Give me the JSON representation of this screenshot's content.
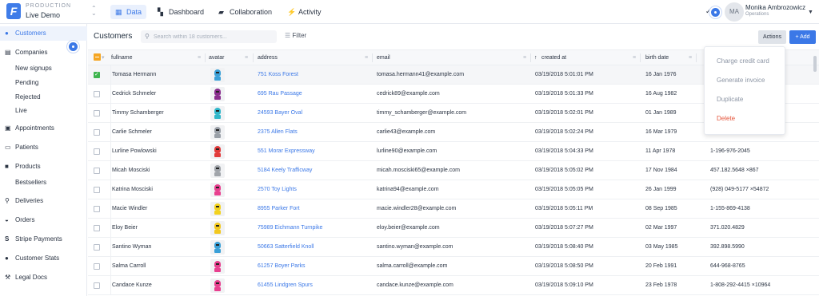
{
  "env": {
    "label": "PRODUCTION",
    "name": "Live Demo"
  },
  "nav": {
    "tabs": [
      {
        "label": "Data",
        "icon": "grid-icon"
      },
      {
        "label": "Dashboard",
        "icon": "dashboard-icon"
      },
      {
        "label": "Collaboration",
        "icon": "chat-icon"
      },
      {
        "label": "Activity",
        "icon": "bolt-icon"
      }
    ]
  },
  "user": {
    "initials": "MA",
    "name": "Monika Ambrozowicz",
    "role": "Operations"
  },
  "sidebar": {
    "items": [
      {
        "label": "Customers",
        "icon": "person-icon"
      },
      {
        "label": "Companies",
        "icon": "building-icon"
      },
      {
        "label": "New signups"
      },
      {
        "label": "Pending"
      },
      {
        "label": "Rejected"
      },
      {
        "label": "Live"
      },
      {
        "label": "Appointments",
        "icon": "calendar-icon"
      },
      {
        "label": "Patients",
        "icon": "id-card-icon"
      },
      {
        "label": "Products",
        "icon": "box-icon"
      },
      {
        "label": "Bestsellers"
      },
      {
        "label": "Deliveries",
        "icon": "pin-icon"
      },
      {
        "label": "Orders",
        "icon": "cart-icon"
      },
      {
        "label": "Stripe Payments",
        "icon": "stripe-icon"
      },
      {
        "label": "Customer Stats",
        "icon": "users-icon"
      },
      {
        "label": "Legal Docs",
        "icon": "gavel-icon"
      }
    ]
  },
  "main": {
    "title": "Customers",
    "search_placeholder": "Search within 18 customers...",
    "filter_label": "Filter",
    "actions_label": "Actions",
    "add_label": "+ Add"
  },
  "table": {
    "columns": [
      "fullname",
      "avatar",
      "address",
      "email",
      "created at",
      "birth date"
    ],
    "rows": [
      {
        "fullname": "Tomasa Hermann",
        "address": "751 Koss Forest",
        "email": "tomasa.hermann41@example.com",
        "created": "03/19/2018 5:01:01 PM",
        "birth": "16 Jan 1976",
        "phone": "",
        "color": "#3aa0d8",
        "checked": true
      },
      {
        "fullname": "Cedrick Schmeler",
        "address": "695 Rau Passage",
        "email": "cedrick89@example.com",
        "created": "03/19/2018 5:01:33 PM",
        "birth": "16 Aug 1982",
        "phone": "",
        "color": "#8a2d8e",
        "checked": false
      },
      {
        "fullname": "Timmy Schamberger",
        "address": "24593 Bayer Oval",
        "email": "timmy_schamberger@example.com",
        "created": "03/19/2018 5:02:01 PM",
        "birth": "01 Jan 1989",
        "phone": "",
        "color": "#2fb6c9",
        "checked": false
      },
      {
        "fullname": "Carlie Schmeler",
        "address": "2375 Allen Flats",
        "email": "carlie43@example.com",
        "created": "03/19/2018 5:02:24 PM",
        "birth": "16 Mar 1979",
        "phone": "",
        "color": "#9aa0a8",
        "checked": false
      },
      {
        "fullname": "Lurline Powlowski",
        "address": "551 Morar Expressway",
        "email": "lurline90@example.com",
        "created": "03/19/2018 5:04:33 PM",
        "birth": "11 Apr 1978",
        "phone": "1-196-976-2045",
        "color": "#e23b3b",
        "checked": false
      },
      {
        "fullname": "Micah Mosciski",
        "address": "5184 Keely Trafficway",
        "email": "micah.mosciski65@example.com",
        "created": "03/19/2018 5:05:02 PM",
        "birth": "17 Nov 1984",
        "phone": "457.182.5648 ×867",
        "color": "#a0a4aa",
        "checked": false
      },
      {
        "fullname": "Katrina Mosciski",
        "address": "2570 Toy Lights",
        "email": "katrina94@example.com",
        "created": "03/19/2018 5:05:05 PM",
        "birth": "26 Jan 1999",
        "phone": "(928) 049-5177 ×54872",
        "color": "#e8408f",
        "checked": false
      },
      {
        "fullname": "Macie Windler",
        "address": "8955 Parker Fort",
        "email": "macie.windler28@example.com",
        "created": "03/19/2018 5:05:11 PM",
        "birth": "08 Sep 1985",
        "phone": "1-155-869-4138",
        "color": "#f2d21f",
        "checked": false
      },
      {
        "fullname": "Eloy Beier",
        "address": "75989 Eichmann Turnpike",
        "email": "eloy.beier@example.com",
        "created": "03/19/2018 5:07:27 PM",
        "birth": "02 Mar 1997",
        "phone": "371.020.4829",
        "color": "#f2c81f",
        "checked": false
      },
      {
        "fullname": "Santino Wyman",
        "address": "50663 Satterfield Knoll",
        "email": "santino.wyman@example.com",
        "created": "03/19/2018 5:08:40 PM",
        "birth": "03 May 1985",
        "phone": "392.898.5990",
        "color": "#3aa0d8",
        "checked": false
      },
      {
        "fullname": "Salma Carroll",
        "address": "61257 Boyer Parks",
        "email": "salma.carroll@example.com",
        "created": "03/19/2018 5:08:50 PM",
        "birth": "20 Feb 1991",
        "phone": "644-968-8765",
        "color": "#e8408f",
        "checked": false
      },
      {
        "fullname": "Candace Kunze",
        "address": "61455 Lindgren Spurs",
        "email": "candace.kunze@example.com",
        "created": "03/19/2018 5:09:10 PM",
        "birth": "23 Feb 1978",
        "phone": "1-808-292-4415 ×10964",
        "color": "#e8408f",
        "checked": false
      }
    ]
  },
  "dropdown": {
    "items": [
      "Charge credit card",
      "Generate invoice",
      "Duplicate",
      "Delete"
    ]
  }
}
